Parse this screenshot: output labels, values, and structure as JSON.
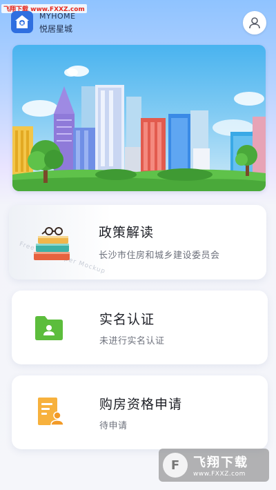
{
  "watermark_top": "飞翔下载 www.FXXZ.com",
  "header": {
    "app_name_en": "MYHOME",
    "app_name_cn": "悦居星城",
    "profile_icon": "user-icon"
  },
  "banner": {
    "image": "city-skyline-illustration"
  },
  "cards": {
    "policy": {
      "title": "政策解读",
      "subtitle": "长沙市住房和城乡建设委员会",
      "background_text": "Free Newspaper Mockup",
      "icon": "books-glasses-icon"
    },
    "realname": {
      "title": "实名认证",
      "subtitle": "未进行实名认证",
      "icon": "user-folder-icon",
      "icon_color": "#5cbd3c"
    },
    "eligibility": {
      "title": "购房资格申请",
      "subtitle": "待申请",
      "icon": "document-user-icon",
      "icon_color": "#f7b13d"
    }
  },
  "watermark_bottom": {
    "brand": "飞翔下载",
    "url": "www.FXXZ.com"
  }
}
